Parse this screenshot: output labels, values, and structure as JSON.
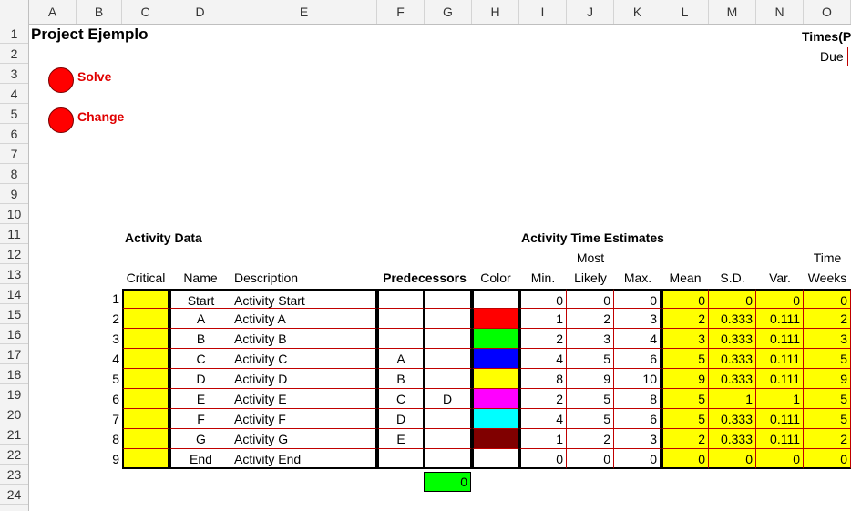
{
  "column_headers": [
    "A",
    "B",
    "C",
    "D",
    "E",
    "F",
    "G",
    "H",
    "I",
    "J",
    "K",
    "L",
    "M",
    "N",
    "O"
  ],
  "row_headers": [
    "1",
    "2",
    "3",
    "4",
    "5",
    "6",
    "7",
    "8",
    "9",
    "10",
    "11",
    "12",
    "13",
    "14",
    "15",
    "16",
    "17",
    "18",
    "19",
    "20",
    "21",
    "22",
    "23",
    "24"
  ],
  "title": "Project Ejemplo",
  "times_label": "Times(P",
  "due_label": "Due",
  "buttons": {
    "solve": "Solve",
    "change": "Change"
  },
  "section_titles": {
    "activity_data": "Activity Data",
    "time_estimates": "Activity Time Estimates"
  },
  "headers": {
    "critical": "Critical",
    "name": "Name",
    "description": "Description",
    "predecessors": "Predecessors",
    "color": "Color",
    "min": "Min.",
    "most": "Most",
    "likely": "Likely",
    "max": "Max.",
    "mean": "Mean",
    "sd": "S.D.",
    "var": "Var.",
    "time": "Time",
    "weeks": "Weeks"
  },
  "colors": {
    "accent_red": "#ff0000",
    "yellow": "#ffff00",
    "grid": "#c00000",
    "total_green": "#00ff00"
  },
  "activities": [
    {
      "num": "1",
      "name": "Start",
      "desc": "Activity Start",
      "p1": "",
      "p2": "",
      "color": "#ffffff",
      "min": "0",
      "likely": "0",
      "max": "0",
      "mean": "0",
      "sd": "0",
      "var": "0",
      "time": "0"
    },
    {
      "num": "2",
      "name": "A",
      "desc": "Activity A",
      "p1": "",
      "p2": "",
      "color": "#ff0000",
      "min": "1",
      "likely": "2",
      "max": "3",
      "mean": "2",
      "sd": "0.333",
      "var": "0.111",
      "time": "2"
    },
    {
      "num": "3",
      "name": "B",
      "desc": "Activity B",
      "p1": "",
      "p2": "",
      "color": "#00ff00",
      "min": "2",
      "likely": "3",
      "max": "4",
      "mean": "3",
      "sd": "0.333",
      "var": "0.111",
      "time": "3"
    },
    {
      "num": "4",
      "name": "C",
      "desc": "Activity C",
      "p1": "A",
      "p2": "",
      "color": "#0000ff",
      "min": "4",
      "likely": "5",
      "max": "6",
      "mean": "5",
      "sd": "0.333",
      "var": "0.111",
      "time": "5"
    },
    {
      "num": "5",
      "name": "D",
      "desc": "Activity D",
      "p1": "B",
      "p2": "",
      "color": "#ffff00",
      "min": "8",
      "likely": "9",
      "max": "10",
      "mean": "9",
      "sd": "0.333",
      "var": "0.111",
      "time": "9"
    },
    {
      "num": "6",
      "name": "E",
      "desc": "Activity E",
      "p1": "C",
      "p2": "D",
      "color": "#ff00ff",
      "min": "2",
      "likely": "5",
      "max": "8",
      "mean": "5",
      "sd": "1",
      "var": "1",
      "time": "5"
    },
    {
      "num": "7",
      "name": "F",
      "desc": "Activity F",
      "p1": "D",
      "p2": "",
      "color": "#00ffff",
      "min": "4",
      "likely": "5",
      "max": "6",
      "mean": "5",
      "sd": "0.333",
      "var": "0.111",
      "time": "5"
    },
    {
      "num": "8",
      "name": "G",
      "desc": "Activity G",
      "p1": "E",
      "p2": "",
      "color": "#800000",
      "min": "1",
      "likely": "2",
      "max": "3",
      "mean": "2",
      "sd": "0.333",
      "var": "0.111",
      "time": "2"
    },
    {
      "num": "9",
      "name": "End",
      "desc": "Activity End",
      "p1": "",
      "p2": "",
      "color": "#ffffff",
      "min": "0",
      "likely": "0",
      "max": "0",
      "mean": "0",
      "sd": "0",
      "var": "0",
      "time": "0"
    }
  ],
  "total_value": "0"
}
